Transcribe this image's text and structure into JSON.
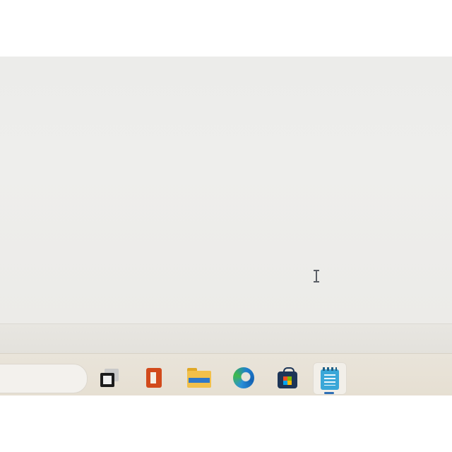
{
  "window": {
    "title": "",
    "content_text": ""
  },
  "taskbar": {
    "search": {
      "placeholder": ""
    },
    "items": [
      {
        "icon": "task-view-icon",
        "active": false
      },
      {
        "icon": "office-icon",
        "active": false
      },
      {
        "icon": "file-explorer-icon",
        "active": false
      },
      {
        "icon": "edge-browser-icon",
        "active": false
      },
      {
        "icon": "microsoft-store-icon",
        "active": false
      },
      {
        "icon": "notepad-icon",
        "active": true
      }
    ],
    "accent_color": "#2f6fb5"
  },
  "colors": {
    "editor_background": "#ececea",
    "taskbar_background": "#e7e1d6"
  }
}
